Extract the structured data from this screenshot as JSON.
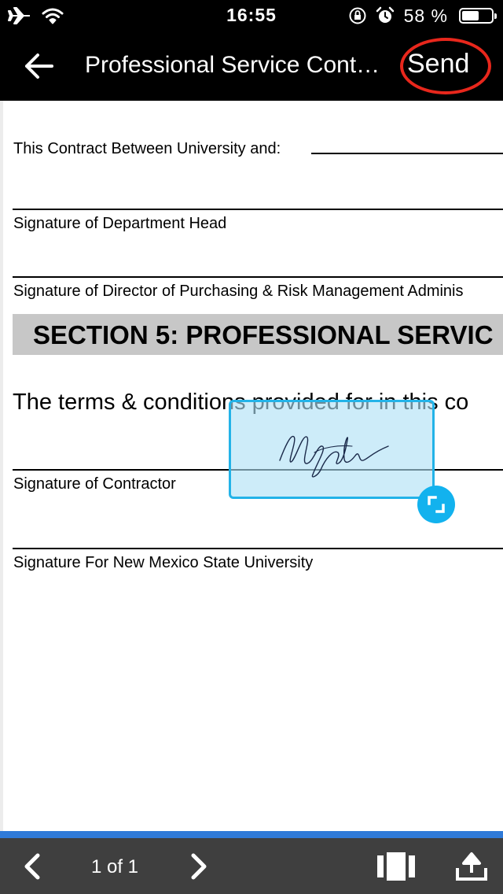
{
  "status_bar": {
    "time": "16:55",
    "battery_percent": "58 %",
    "battery_level": 0.58,
    "icons": [
      "airplane-icon",
      "wifi-icon",
      "orientation-lock-icon",
      "alarm-icon",
      "battery-icon"
    ]
  },
  "nav": {
    "back_icon": "arrow-left-icon",
    "title": "Professional Service Cont…",
    "send_label": "Send",
    "highlight_color": "#e8271c"
  },
  "document": {
    "contract_between": "This Contract Between University and:",
    "sig_department_head": "Signature of Department Head",
    "sig_director": "Signature of Director of Purchasing & Risk Management Adminis",
    "section_heading": "SECTION 5: PROFESSIONAL SERVIC",
    "terms_text": "The terms & conditions provided for in this co",
    "sig_contractor": "Signature of Contractor",
    "sig_nmsu": "Signature For New Mexico State University"
  },
  "signature_overlay": {
    "box_color": "#23b3e8",
    "handle_icon": "resize-icon"
  },
  "toolbar": {
    "prev_icon": "chevron-left-icon",
    "page_indicator": "1 of 1",
    "next_icon": "chevron-right-icon",
    "pages_icon": "page-thumbnails-icon",
    "share_icon": "share-upload-icon",
    "accent_color": "#2f7ad8"
  }
}
